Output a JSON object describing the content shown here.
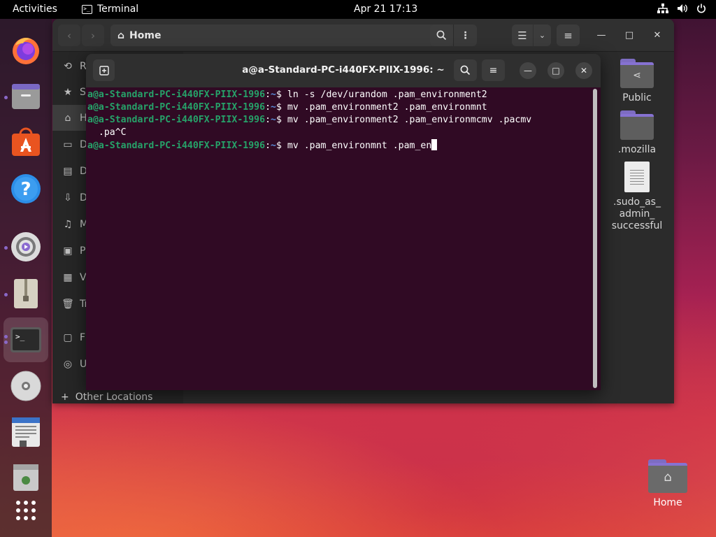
{
  "topbar": {
    "activities": "Activities",
    "app_name": "Terminal",
    "clock": "Apr 21  17:13",
    "tray_network_icon": "network-icon",
    "tray_volume_icon": "volume-icon",
    "tray_power_icon": "power-icon"
  },
  "dock": {
    "items": [
      {
        "name": "firefox",
        "running": false
      },
      {
        "name": "files",
        "running": true
      },
      {
        "name": "app-center",
        "running": false
      },
      {
        "name": "help",
        "running": false
      },
      {
        "name": "settings",
        "running": true
      },
      {
        "name": "archive-manager",
        "running": true
      },
      {
        "name": "terminal",
        "running": true,
        "active": true
      },
      {
        "name": "disc",
        "running": false
      },
      {
        "name": "text-editor",
        "running": false
      },
      {
        "name": "trash",
        "running": false
      },
      {
        "name": "show-apps",
        "running": false
      }
    ]
  },
  "files": {
    "location": "Home",
    "sidebar": {
      "items": [
        {
          "glyph": "⟲",
          "label": "Re"
        },
        {
          "glyph": "★",
          "label": "St"
        },
        {
          "glyph": "⌂",
          "label": "Ho"
        },
        {
          "glyph": "▭",
          "label": "De"
        },
        {
          "glyph": "▤",
          "label": "Do"
        },
        {
          "glyph": "⇩",
          "label": "Do"
        },
        {
          "glyph": "♫",
          "label": "Mu"
        },
        {
          "glyph": "▣",
          "label": "Pi"
        },
        {
          "glyph": "▦",
          "label": "Vi"
        },
        {
          "glyph": "🗑",
          "label": "Tr"
        },
        {
          "glyph": "▢",
          "label": "Fl"
        },
        {
          "glyph": "◎",
          "label": "U"
        }
      ],
      "other_locations": "Other Locations"
    },
    "content": [
      {
        "type": "folder-shared",
        "label": "Public"
      },
      {
        "type": "folder",
        "label": ".mozilla"
      },
      {
        "type": "document",
        "label": ".sudo_as_\nadmin_\nsuccessful"
      }
    ]
  },
  "terminal": {
    "title": "a@a-Standard-PC-i440FX-PIIX-1996: ~",
    "prompt_user": "a@a-Standard-PC-i440FX-PIIX-1996",
    "prompt_path": "~",
    "lines": [
      {
        "cmd": "ln -s /dev/urandom .pam_environment2"
      },
      {
        "cmd": "mv .pam_environment2 .pam_environmnt"
      },
      {
        "cmd": "mv .pam_environment2 .pam_environmcmv .pacmv"
      },
      {
        "continuation": "  .pa^C"
      },
      {
        "cmd": "mv .pam_environmnt .pam_en",
        "cursor": true
      }
    ]
  },
  "desktop": {
    "home_label": "Home"
  },
  "colors": {
    "terminal_bg": "#300a24",
    "prompt_user": "#26a269",
    "prompt_path": "#5a8cd8",
    "accent_folder": "#8672d2"
  }
}
